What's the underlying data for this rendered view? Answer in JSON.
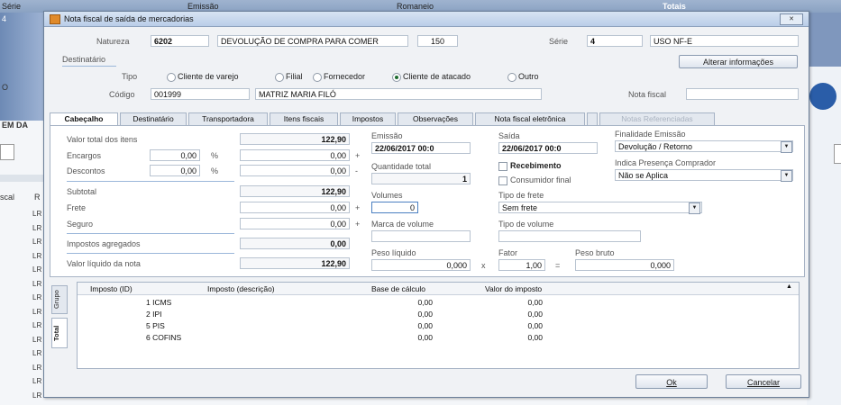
{
  "background": {
    "header_cols": [
      "Série",
      "Emissão",
      "Romaneio",
      "Totais"
    ],
    "serie_value": "4",
    "left_labels": [
      "O",
      "EM DA",
      "scal",
      "R"
    ],
    "lr_rows": [
      "LR",
      "LR",
      "LR",
      "LR",
      "LR",
      "LR",
      "LR",
      "LR",
      "LR",
      "LR",
      "LR",
      "LR",
      "LR",
      "LR"
    ]
  },
  "dialog": {
    "title": "Nota fiscal de saída de mercadorias",
    "close_label": "✕"
  },
  "top": {
    "natureza_label": "Natureza",
    "natureza_code": "6202",
    "natureza_desc": "DEVOLUÇÃO DE COMPRA PARA COMER",
    "natureza_num": "150",
    "serie_label": "Série",
    "serie_value": "4",
    "serie_desc": "USO NF-E",
    "destinatario_label": "Destinatário",
    "tipo_label": "Tipo",
    "tipo_options": [
      "Cliente de varejo",
      "Filial",
      "Fornecedor",
      "Cliente de atacado",
      "Outro"
    ],
    "tipo_selected": "Cliente de atacado",
    "alterar_label": "Alterar informações",
    "codigo_label": "Código",
    "codigo_value": "001999",
    "nome_value": "MATRIZ MARIA FILÓ",
    "nota_fiscal_label": "Nota fiscal",
    "nota_fiscal_value": ""
  },
  "tabs": [
    "Cabeçalho",
    "Destinatário",
    "Transportadora",
    "Itens fiscais",
    "Impostos",
    "Observações",
    "Nota fiscal eletrônica",
    "",
    "Notas Referenciadas"
  ],
  "cabecalho": {
    "valor_total_label": "Valor total dos itens",
    "valor_total": "122,90",
    "encargos_label": "Encargos",
    "encargos_pct": "0,00",
    "encargos_val": "0,00",
    "descontos_label": "Descontos",
    "descontos_pct": "0,00",
    "descontos_val": "0,00",
    "pct_symbol": "%",
    "plus": "+",
    "minus": "-",
    "x": "x",
    "eq": "=",
    "subtotal_label": "Subtotal",
    "subtotal": "122,90",
    "frete_label": "Frete",
    "frete": "0,00",
    "seguro_label": "Seguro",
    "seguro": "0,00",
    "impostos_label": "Impostos agregados",
    "impostos": "0,00",
    "liquido_label": "Valor líquido da nota",
    "liquido": "122,90",
    "emissao_label": "Emissão",
    "emissao": "22/06/2017 00:0",
    "saida_label": "Saída",
    "saida": "22/06/2017 00:0",
    "finalidade_label": "Finalidade Emissão",
    "finalidade": "Devolução / Retorno",
    "qtd_total_label": "Quantidade total",
    "qtd_total": "1",
    "recebimento_label": "Recebimento",
    "consumidor_label": "Consumidor final",
    "presenca_label": "Indica Presença Comprador",
    "presenca": "Não se Aplica",
    "volumes_label": "Volumes",
    "volumes": "0",
    "tipo_frete_label": "Tipo de frete",
    "tipo_frete": "Sem frete",
    "marca_label": "Marca de volume",
    "tipo_volume_label": "Tipo de volume",
    "peso_liquido_label": "Peso líquido",
    "peso_liquido": "0,000",
    "fator_label": "Fator",
    "fator": "1,00",
    "peso_bruto_label": "Peso bruto",
    "peso_bruto": "0,000"
  },
  "grid": {
    "side_tabs": [
      "Grupo",
      "Total"
    ],
    "headers": [
      "Imposto (ID)",
      "Imposto (descrição)",
      "Base de cálculo",
      "Valor do imposto"
    ],
    "rows": [
      [
        "1 ICMS",
        "",
        "0,00",
        "0,00"
      ],
      [
        "2 IPI",
        "",
        "0,00",
        "0,00"
      ],
      [
        "5 PIS",
        "",
        "0,00",
        "0,00"
      ],
      [
        "6 COFINS",
        "",
        "0,00",
        "0,00"
      ]
    ]
  },
  "footer": {
    "ok_label": "Ok",
    "cancel_label": "Cancelar"
  }
}
